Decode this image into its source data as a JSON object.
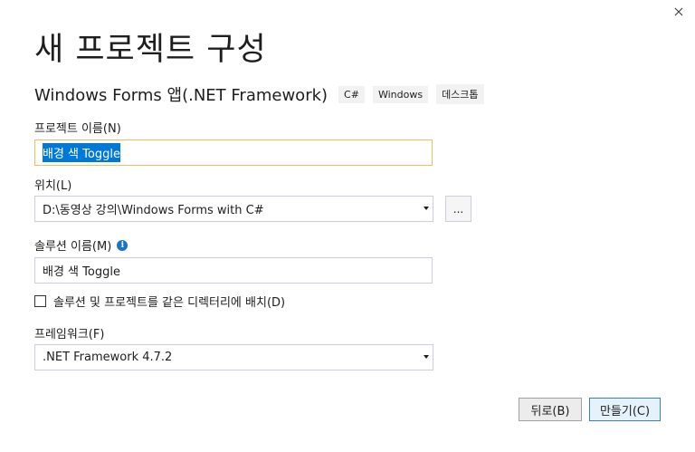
{
  "dialog": {
    "title": "새 프로젝트 구성",
    "close_icon": "close-icon"
  },
  "template": {
    "name": "Windows Forms 앱(.NET Framework)",
    "tags": [
      "C#",
      "Windows",
      "데스크톱"
    ]
  },
  "project_name": {
    "label": "프로젝트 이름(N)",
    "value": "배경 색 Toggle"
  },
  "location": {
    "label": "위치(L)",
    "value": "D:\\동영상 강의\\Windows Forms with C#",
    "browse_label": "..."
  },
  "solution_name": {
    "label": "솔루션 이름(M)",
    "info_icon": "info-icon",
    "value": "배경 색 Toggle"
  },
  "same_directory": {
    "label": "솔루션 및 프로젝트를 같은 디렉터리에 배치(D)",
    "checked": false
  },
  "framework": {
    "label": "프레임워크(F)",
    "value": ".NET Framework 4.7.2"
  },
  "buttons": {
    "back_label": "뒤로(B)",
    "create_label": "만들기(C)"
  }
}
